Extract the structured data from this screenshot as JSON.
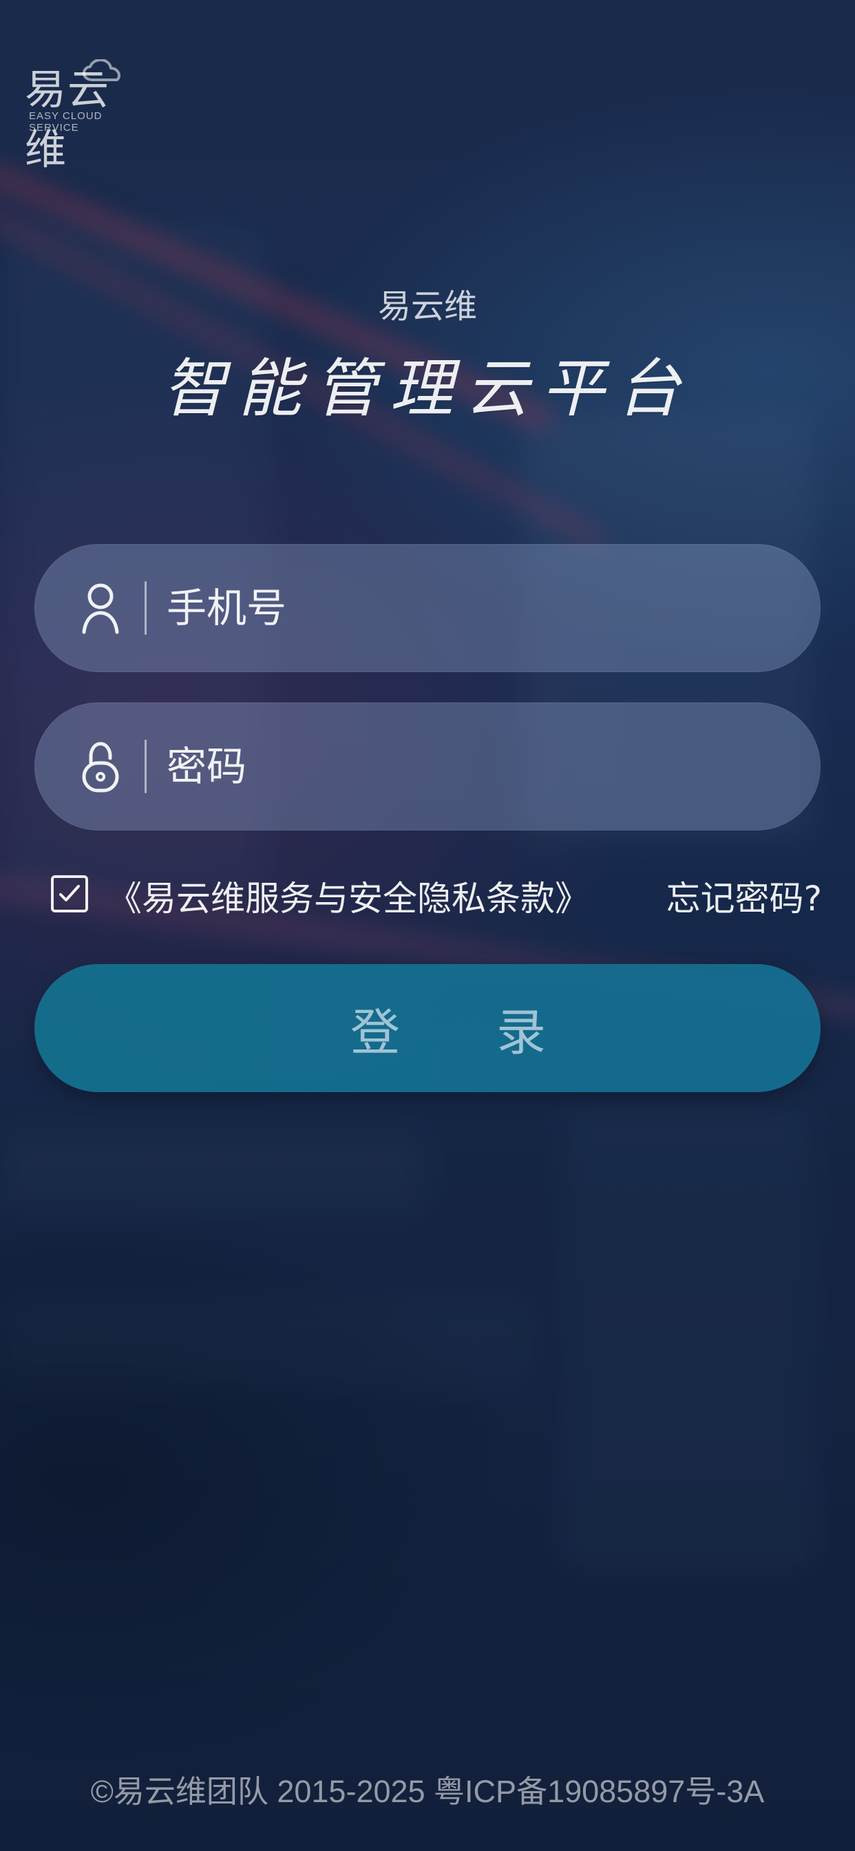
{
  "branding": {
    "logo_text": "易云维",
    "logo_subtitle": "EASY CLOUD SERVICE",
    "brand_name": "易云维",
    "slogan": "智能管理云平台"
  },
  "login_form": {
    "phone_placeholder": "手机号",
    "password_placeholder": "密码",
    "terms_label": "《易云维服务与安全隐私条款》",
    "terms_checked": true,
    "forgot_password_label": "忘记密码?",
    "login_button_label": "登 录"
  },
  "footer": {
    "copyright": "©易云维团队 2015-2025 粤ICP备19085897号-3A"
  },
  "icons": {
    "user": "user-icon",
    "lock": "lock-icon",
    "check": "check-icon",
    "cloud": "cloud-icon"
  },
  "colors": {
    "login_button": "#137896",
    "field_bg": "rgba(150,170,210,0.35)",
    "text": "#ffffff"
  }
}
